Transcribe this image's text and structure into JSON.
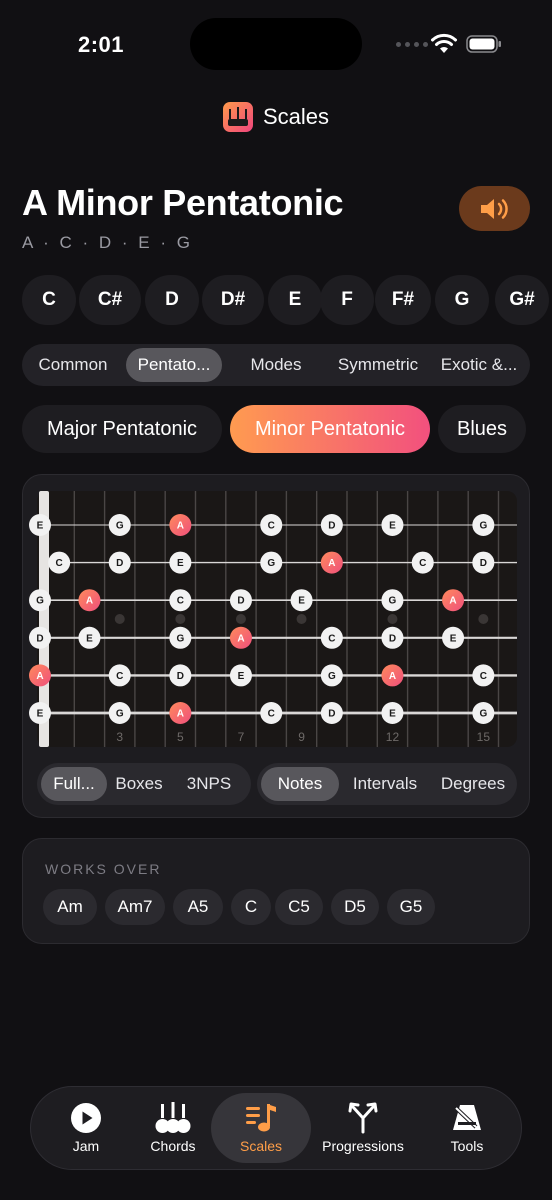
{
  "status": {
    "time": "2:01"
  },
  "header": {
    "title": "Scales"
  },
  "scale": {
    "name": "A Minor Pentatonic",
    "notes": "A · C · D · E · G"
  },
  "roots": [
    "C",
    "C#",
    "D",
    "D#",
    "E",
    "F",
    "F#",
    "G",
    "G#"
  ],
  "categories": {
    "items": [
      "Common",
      "Pentato...",
      "Modes",
      "Symmetric",
      "Exotic &..."
    ],
    "active": "Pentato..."
  },
  "scale_chips": {
    "items": [
      "Major Pentatonic",
      "Minor Pentatonic",
      "Blues"
    ],
    "active": "Minor Pentatonic"
  },
  "fretboard": {
    "strings": [
      {
        "open": "E",
        "notes": [
          null,
          null,
          "G",
          null,
          "A",
          null,
          null,
          "C",
          null,
          "D",
          null,
          "E",
          null,
          null,
          "G"
        ]
      },
      {
        "open": null,
        "notes": [
          "C",
          null,
          "D",
          null,
          "E",
          null,
          null,
          "G",
          null,
          "A",
          null,
          null,
          "C",
          null,
          "D"
        ]
      },
      {
        "open": "G",
        "notes": [
          null,
          "A",
          null,
          null,
          "C",
          null,
          "D",
          null,
          "E",
          null,
          null,
          "G",
          null,
          "A",
          null
        ]
      },
      {
        "open": "D",
        "notes": [
          null,
          "E",
          null,
          null,
          "G",
          null,
          "A",
          null,
          null,
          "C",
          null,
          "D",
          null,
          "E",
          null
        ]
      },
      {
        "open": "A",
        "notes": [
          null,
          null,
          "C",
          null,
          "D",
          null,
          "E",
          null,
          null,
          "G",
          null,
          "A",
          null,
          null,
          "C"
        ]
      },
      {
        "open": "E",
        "notes": [
          null,
          null,
          "G",
          null,
          "A",
          null,
          null,
          "C",
          null,
          "D",
          null,
          "E",
          null,
          null,
          "G"
        ]
      }
    ],
    "root_note": "A",
    "fret_numbers": [
      {
        "fret": 3,
        "label": "3"
      },
      {
        "fret": 5,
        "label": "5"
      },
      {
        "fret": 7,
        "label": "7"
      },
      {
        "fret": 9,
        "label": "9"
      },
      {
        "fret": 12,
        "label": "12"
      },
      {
        "fret": 15,
        "label": "15"
      }
    ],
    "inlay_frets": [
      3,
      5,
      7,
      9,
      12,
      15
    ],
    "colors": {
      "root_start": "#ff8a5c",
      "root_end": "#ef4f7c",
      "note_bg": "#f2f2f2",
      "note_text": "#1a1a1a"
    }
  },
  "view_mode": {
    "items": [
      "Full...",
      "Boxes",
      "3NPS"
    ],
    "active": "Full..."
  },
  "label_mode": {
    "items": [
      "Notes",
      "Intervals",
      "Degrees"
    ],
    "active": "Notes"
  },
  "works_over": {
    "label": "WORKS OVER",
    "chords": [
      "Am",
      "Am7",
      "A5",
      "C",
      "C5",
      "D5",
      "G5"
    ]
  },
  "tabs": {
    "items": [
      "Jam",
      "Chords",
      "Scales",
      "Progressions",
      "Tools"
    ],
    "active": "Scales"
  },
  "colors": {
    "accent": "#ff9e48",
    "background": "#111013",
    "card": "#1d1c20"
  }
}
